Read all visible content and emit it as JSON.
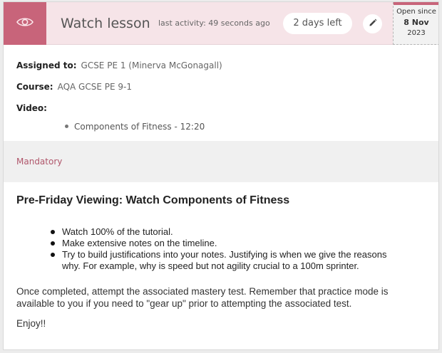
{
  "header": {
    "title": "Watch lesson",
    "last_activity": "last activity: 49 seconds ago",
    "days_left": "2 days left",
    "open_since_label": "Open since",
    "open_since_date": "8 Nov",
    "open_since_year": "2023",
    "accent_color": "#c8647a",
    "icon": "eye-icon",
    "edit_icon": "pencil-icon"
  },
  "meta": {
    "assigned_label": "Assigned to:",
    "assigned_value": "GCSE PE 1 (Minerva McGonagall)",
    "course_label": "Course:",
    "course_value": "AQA GCSE PE 9-1",
    "video_label": "Video:",
    "videos": [
      "Components of Fitness - 12:20"
    ]
  },
  "mandatory_label": "Mandatory",
  "lesson": {
    "title": "Pre-Friday Viewing: Watch Components of Fitness",
    "bullets": [
      "Watch 100% of the tutorial.",
      "Make extensive notes on the timeline.",
      "Try to build justifications into your notes. Justifying is when we give the reasons why. For example, why is speed but not agility crucial to a 100m sprinter."
    ],
    "paragraph": "Once completed, attempt the associated mastery test. Remember that practice mode is available to you if you need to \"gear up\" prior to attempting the associated test.",
    "closing": "Enjoy!!"
  }
}
